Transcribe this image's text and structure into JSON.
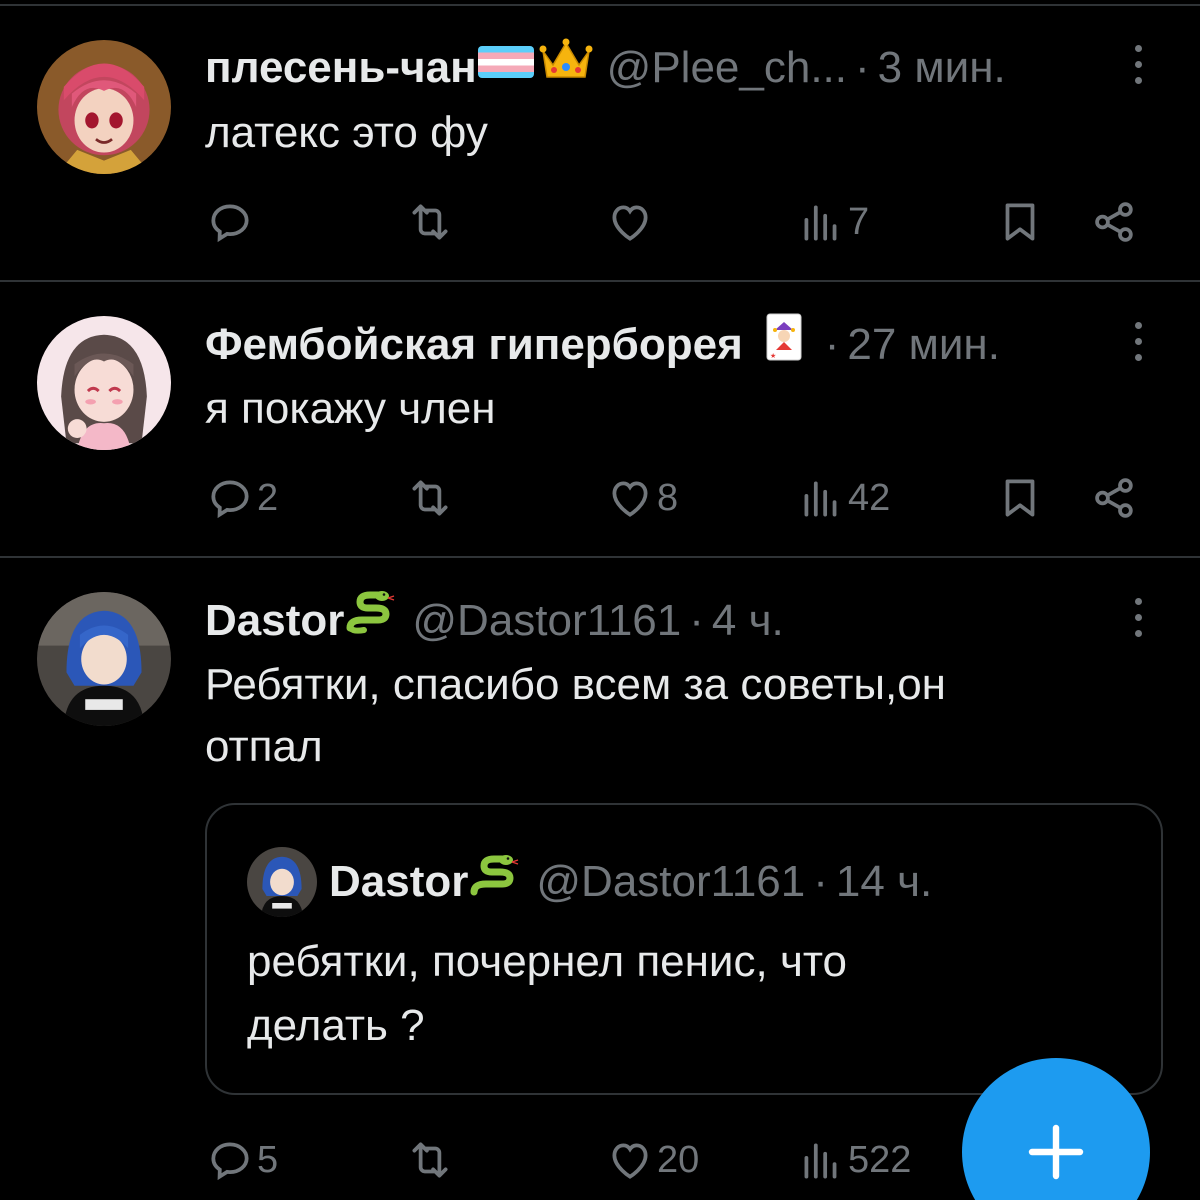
{
  "tweets": [
    {
      "name": "плесень-чан",
      "handle": "@Plee_ch...",
      "sep": "·",
      "time": "3 мин.",
      "text": "латекс это фу",
      "reply_count": "",
      "retweet_count": "",
      "like_count": "",
      "view_count": "7"
    },
    {
      "name": "Фембойская гиперборея",
      "handle": "",
      "sep": "·",
      "time": "27 мин.",
      "text": "я покажу член",
      "reply_count": "2",
      "retweet_count": "",
      "like_count": "8",
      "view_count": "42"
    },
    {
      "name": "Dastor",
      "handle": "@Dastor1161",
      "sep": "·",
      "time": "4 ч.",
      "text": "Ребятки, спасибо всем за советы,он отпал",
      "reply_count": "5",
      "retweet_count": "",
      "like_count": "20",
      "view_count": "522",
      "quote": {
        "name": "Dastor",
        "handle": "@Dastor1161",
        "sep": "·",
        "time": "14 ч.",
        "text": "ребятки, почернел пенис, что делать ?"
      }
    }
  ],
  "icons": {
    "reply": "reply-icon",
    "retweet": "retweet-icon",
    "like": "heart-icon",
    "views": "views-icon",
    "bookmark": "bookmark-icon",
    "share": "share-icon",
    "compose": "plus-icon"
  },
  "colors": {
    "background": "#000000",
    "text": "#e7e9ea",
    "muted": "#71767b",
    "accent": "#1d9bf0",
    "divider": "#2f3336"
  }
}
